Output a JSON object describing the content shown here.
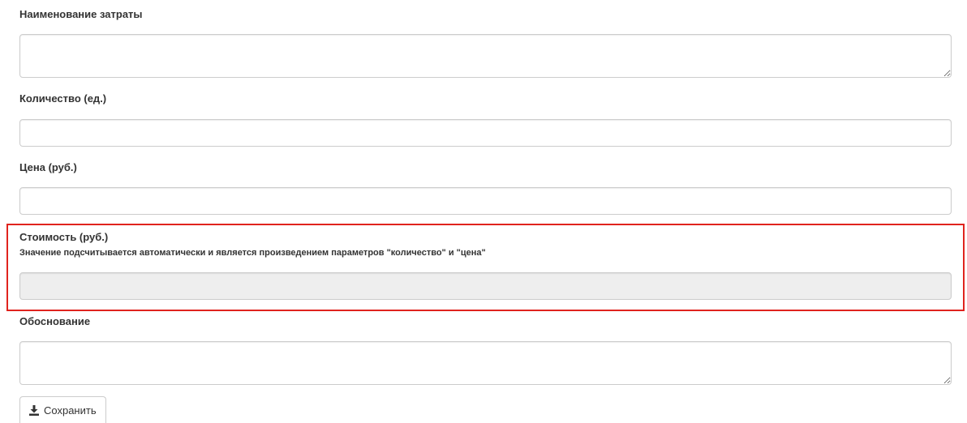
{
  "form": {
    "expense_name": {
      "label": "Наименование затраты",
      "value": ""
    },
    "quantity": {
      "label": "Количество (ед.)",
      "value": ""
    },
    "price": {
      "label": "Цена (руб.)",
      "value": ""
    },
    "cost": {
      "label": "Стоимость (руб.)",
      "hint": "Значение подсчитывается автоматически и является произведением параметров \"количество\" и \"цена\"",
      "value": "",
      "readonly": true
    },
    "justification": {
      "label": "Обоснование",
      "value": ""
    },
    "save_button": {
      "label": "Сохранить",
      "icon": "download-icon"
    }
  },
  "colors": {
    "highlight_border": "#e0231e",
    "field_border": "#cccccc",
    "readonly_background": "#eeeeee",
    "label_text": "#333333"
  }
}
